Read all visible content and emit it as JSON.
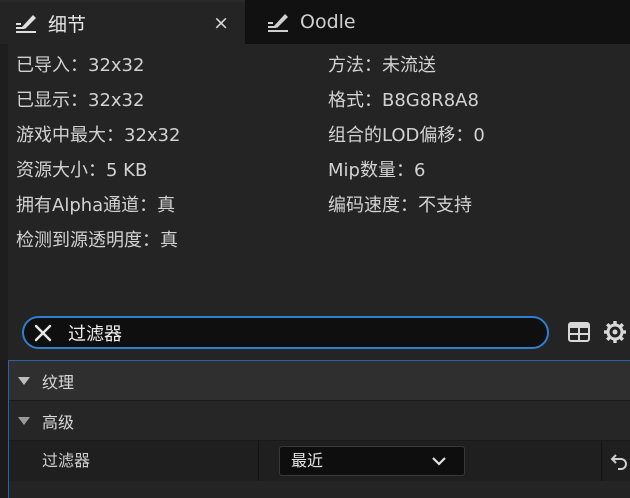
{
  "tabs": [
    {
      "label": "细节",
      "icon": "details-pencil-icon",
      "close": "×"
    },
    {
      "label": "Oodle",
      "icon": "oodle-pencil-icon"
    }
  ],
  "info_left": [
    "已导入：32x32",
    "已显示：32x32",
    "游戏中最大：32x32",
    "资源大小：5 KB",
    "拥有Alpha通道：真",
    "检测到源透明度：真"
  ],
  "info_right": [
    "方法：未流送",
    "格式：B8G8R8A8",
    "组合的LOD偏移：0",
    "Mip数量：6",
    "编码速度：不支持"
  ],
  "search": {
    "value": "过滤器"
  },
  "categories": [
    {
      "label": "纹理"
    },
    {
      "label": "高级"
    }
  ],
  "property": {
    "name": "过滤器",
    "value": "最近"
  },
  "colors": {
    "accent": "#2e7fd1",
    "background": "#1b1b1b",
    "panel": "#242424"
  }
}
